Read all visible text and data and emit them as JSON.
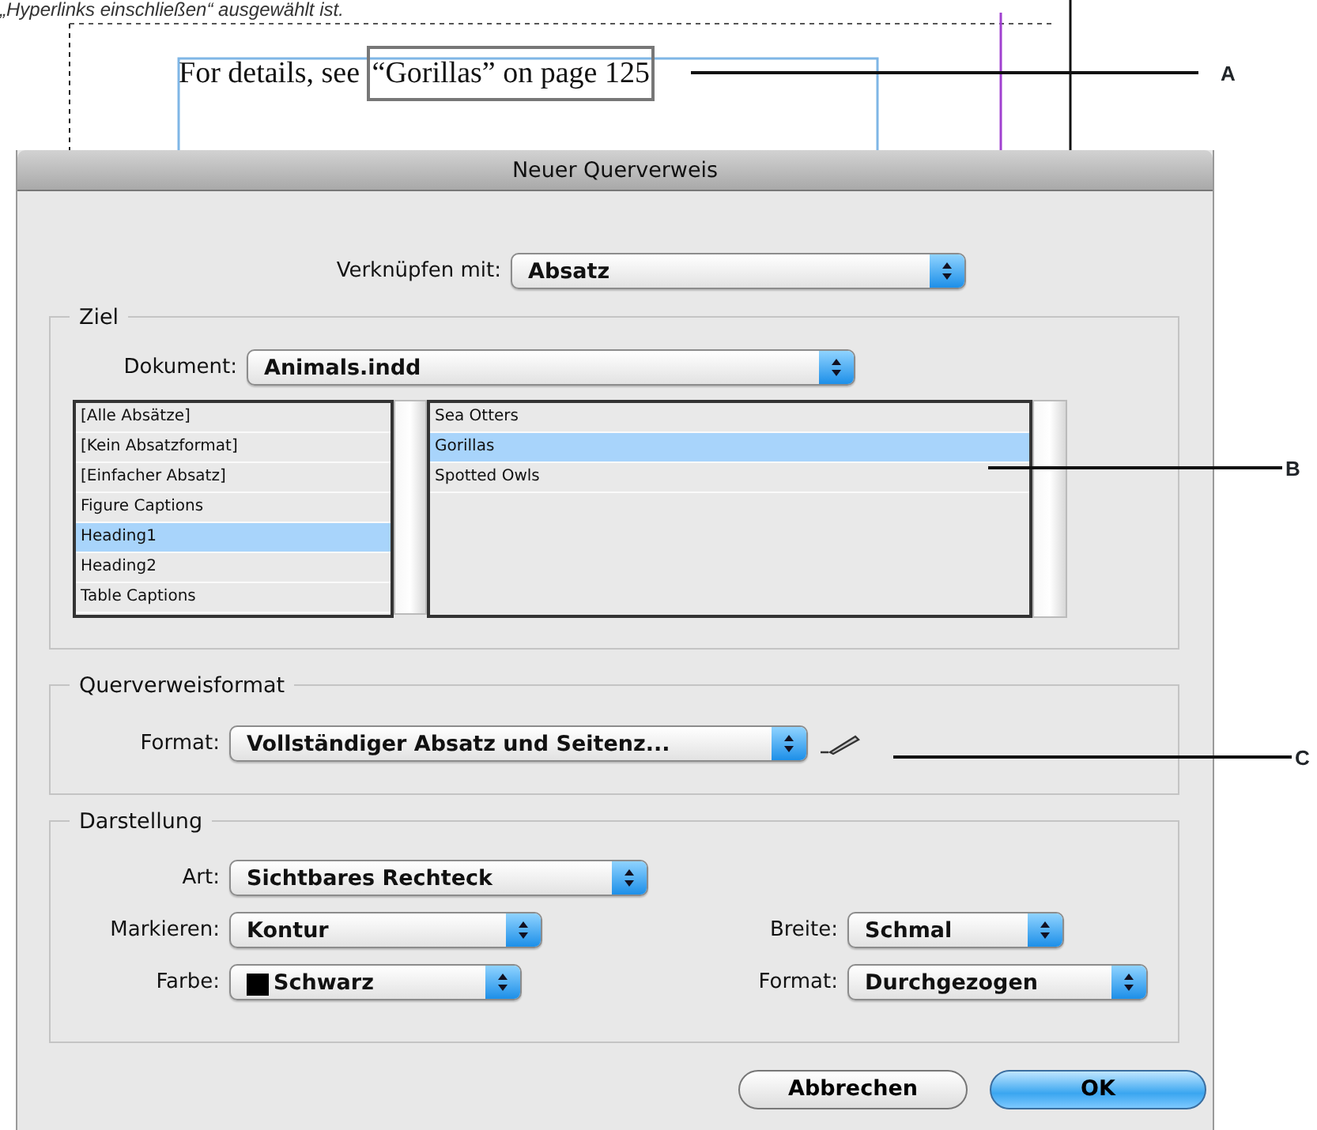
{
  "caption": "„Hyperlinks einschließen“ ausgewählt ist.",
  "document": {
    "text": "For details, see ",
    "boxed_text": "“Gorillas” on page 125"
  },
  "dialog": {
    "title": "Neuer Querverweis",
    "link_to": {
      "label": "Verknüpfen mit:",
      "value": "Absatz"
    },
    "target": {
      "legend": "Ziel",
      "document": {
        "label": "Dokument:",
        "value": "Animals.indd"
      },
      "paragraph_styles": [
        {
          "label": "[Alle Absätze]",
          "selected": false
        },
        {
          "label": "[Kein Absatzformat]",
          "selected": false
        },
        {
          "label": "[Einfacher Absatz]",
          "selected": false
        },
        {
          "label": "Figure Captions",
          "selected": false
        },
        {
          "label": "Heading1",
          "selected": true
        },
        {
          "label": "Heading2",
          "selected": false
        },
        {
          "label": "Table Captions",
          "selected": false
        }
      ],
      "paragraphs": [
        {
          "label": "Sea Otters",
          "selected": false
        },
        {
          "label": "Gorillas",
          "selected": true
        },
        {
          "label": "Spotted Owls",
          "selected": false
        }
      ]
    },
    "format_group": {
      "legend": "Querverweisformat",
      "format": {
        "label": "Format:",
        "value": "Vollständiger Absatz und Seitenz..."
      }
    },
    "appearance": {
      "legend": "Darstellung",
      "type": {
        "label": "Art:",
        "value": "Sichtbares Rechteck"
      },
      "highlight": {
        "label": "Markieren:",
        "value": "Kontur"
      },
      "width": {
        "label": "Breite:",
        "value": "Schmal"
      },
      "color": {
        "label": "Farbe:",
        "value": "Schwarz"
      },
      "style": {
        "label": "Format:",
        "value": "Durchgezogen"
      }
    },
    "buttons": [
      {
        "label": "Abbrechen",
        "default": false
      },
      {
        "label": "OK",
        "default": true
      }
    ]
  },
  "callouts": [
    {
      "label": "A"
    },
    {
      "label": "B"
    },
    {
      "label": "C"
    }
  ]
}
